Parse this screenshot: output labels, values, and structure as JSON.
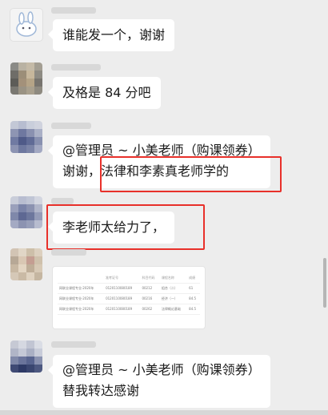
{
  "chat": {
    "messages": [
      {
        "text": "谁能发一个，谢谢"
      },
      {
        "text": "及格是 84 分吧"
      },
      {
        "line1": "@管理员 ~ 小美老师（购课领券）",
        "line2": "谢谢，法律和李素真老师学的"
      },
      {
        "text": "李老师太给力了，"
      },
      {
        "image_table": {
          "header": [
            "",
            "准考证号",
            "科目代码",
            "课程名称",
            "成绩"
          ],
          "rows": [
            [
              "网联业课程专业·2020年",
              "0120110080189",
              "00212",
              "组合（二）",
              "61"
            ],
            [
              "网联业课程专业·2020年",
              "0120110080189",
              "00216",
              "经济（一）",
              "84.5"
            ],
            [
              "网联业课程专业·2020年",
              "0120110080189",
              "00262",
              "法律概论基础",
              "84.5"
            ]
          ]
        }
      },
      {
        "line1": "@管理员 ~ 小美老师（购课领券）",
        "line2": "替我转达感谢"
      }
    ]
  },
  "colors": {
    "background": "#ededed",
    "bubble": "#ffffff",
    "highlight_box": "#e8302a"
  }
}
